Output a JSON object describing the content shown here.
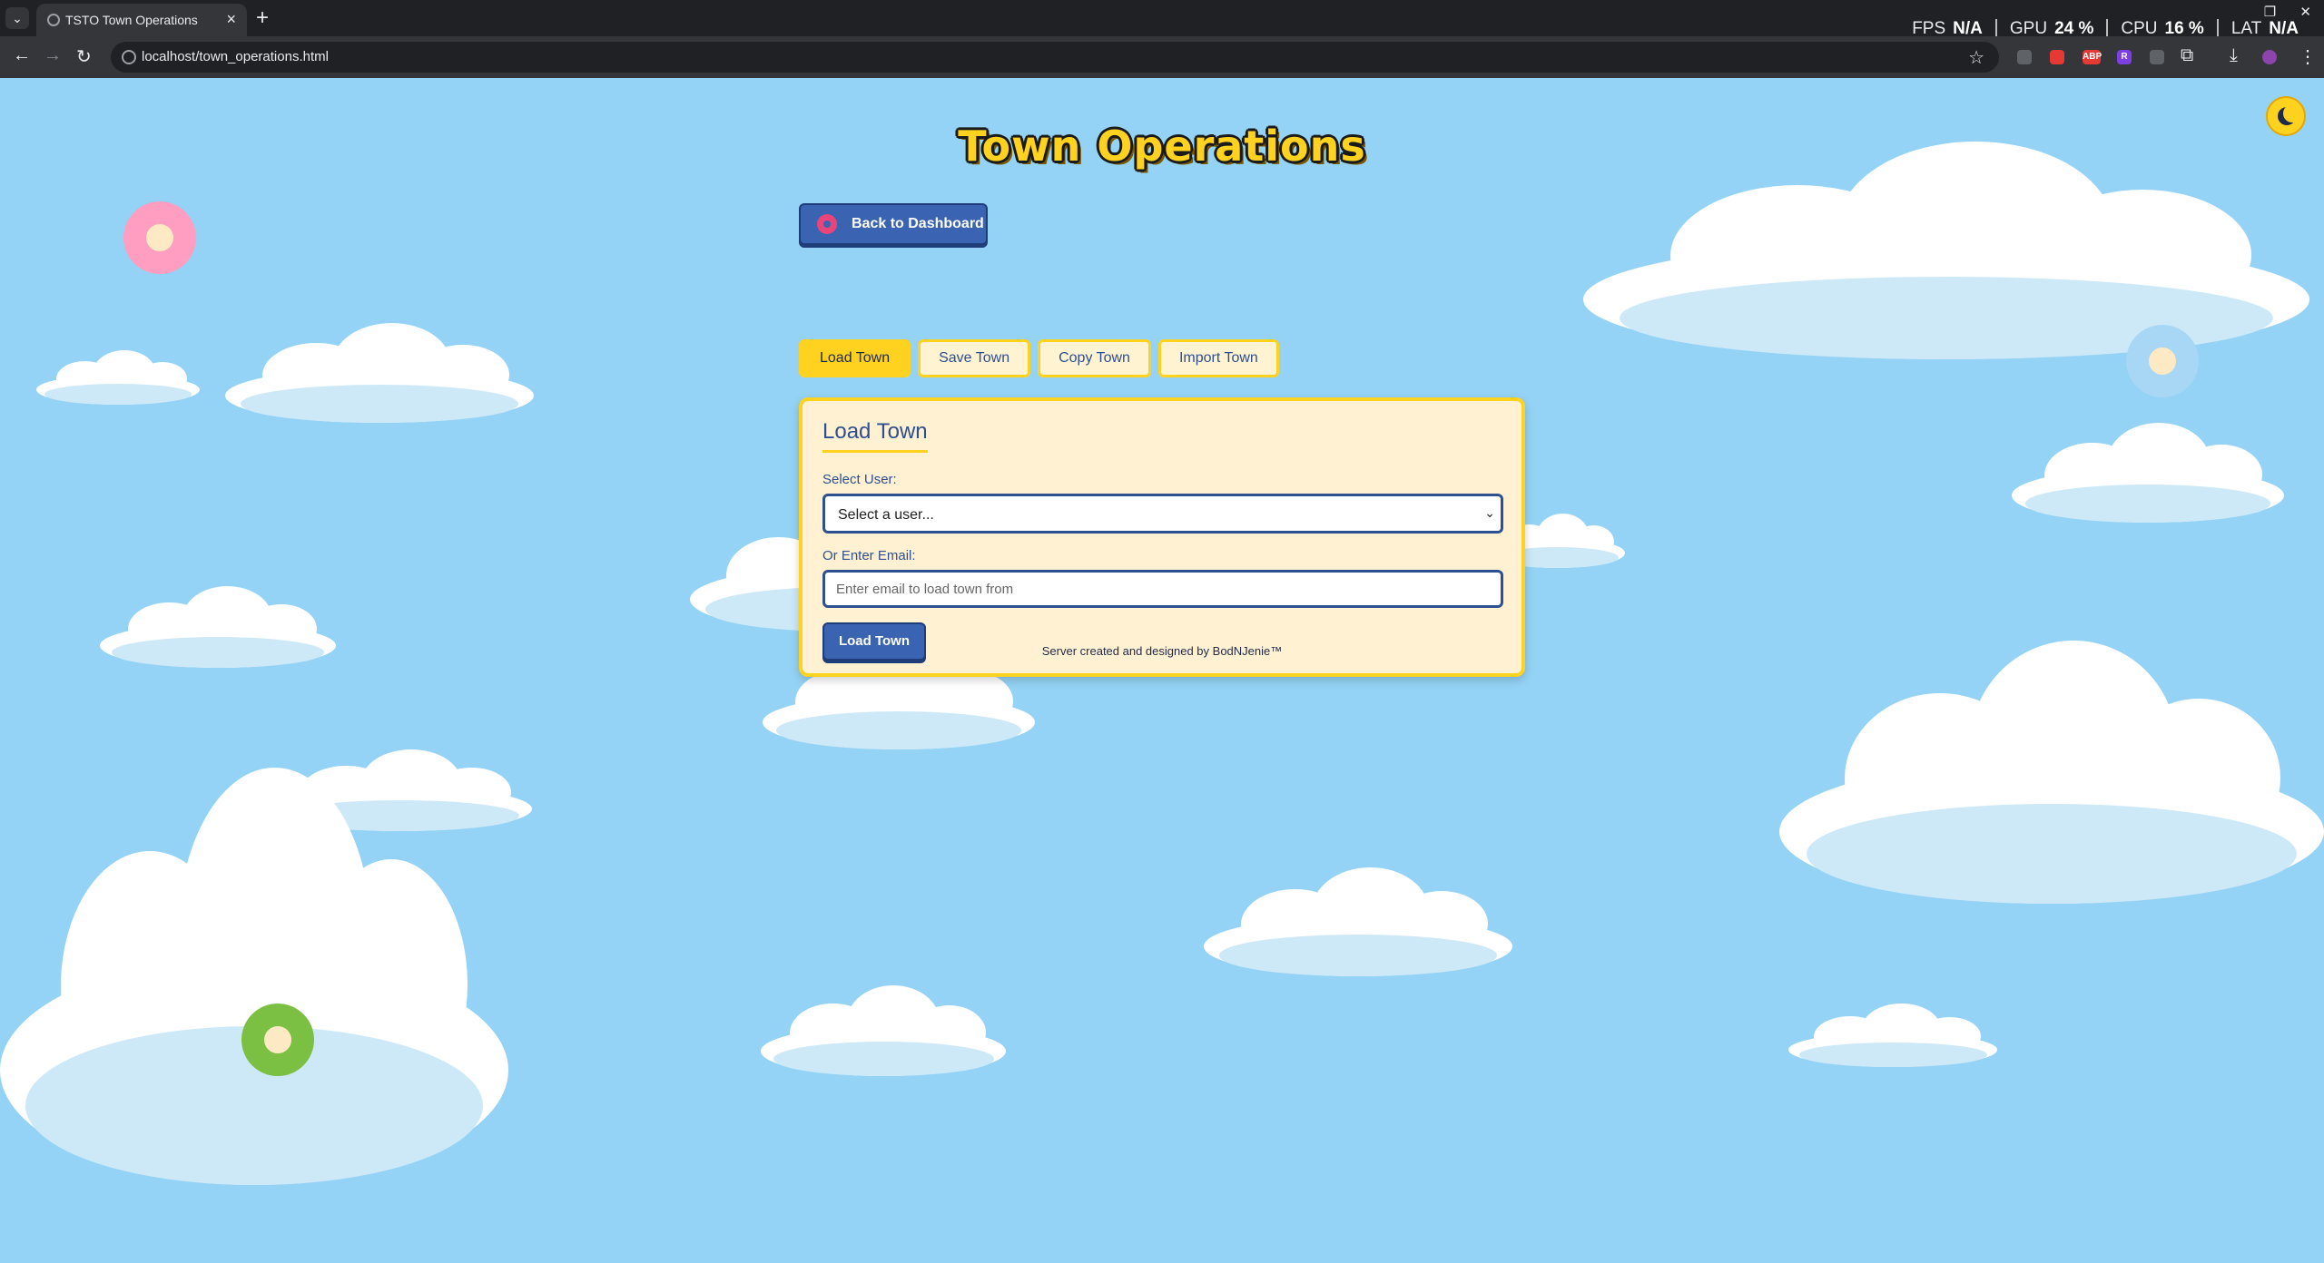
{
  "browser": {
    "tab_title": "TSTO Town Operations",
    "url": "localhost/town_operations.html",
    "perf": [
      {
        "label": "FPS",
        "value": "N/A"
      },
      {
        "label": "GPU",
        "value": "24 %"
      },
      {
        "label": "CPU",
        "value": "16 %"
      },
      {
        "label": "LAT",
        "value": "N/A"
      }
    ],
    "extensions": [
      {
        "icon": "shield-extension-icon",
        "color": "#5f6368",
        "text": ""
      },
      {
        "icon": "red-extension-icon",
        "color": "#e53935",
        "text": ""
      },
      {
        "icon": "adblock-plus-icon",
        "color": "#e53935",
        "text": "ABP"
      },
      {
        "icon": "r-extension-icon",
        "color": "#7b3fe4",
        "text": "R"
      },
      {
        "icon": "gray-extension-icon",
        "color": "#5f6368",
        "text": ""
      }
    ]
  },
  "page": {
    "title": "Town Operations",
    "back_button": "Back to Dashboard",
    "tabs": [
      "Load Town",
      "Save Town",
      "Copy Town",
      "Import Town"
    ],
    "active_tab": "Load Town",
    "card": {
      "title": "Load Town",
      "select_label": "Select User:",
      "select_value": "Select a user...",
      "email_label": "Or Enter Email:",
      "email_placeholder": "Enter email to load town from",
      "email_value": "",
      "submit_label": "Load Town"
    },
    "footer": "Server created and designed by BodNJenie™"
  },
  "colors": {
    "sky": "#94d3f5",
    "accent_yellow": "#ffd21f",
    "primary_blue": "#3a64b2",
    "card_bg": "#fff1d2"
  }
}
